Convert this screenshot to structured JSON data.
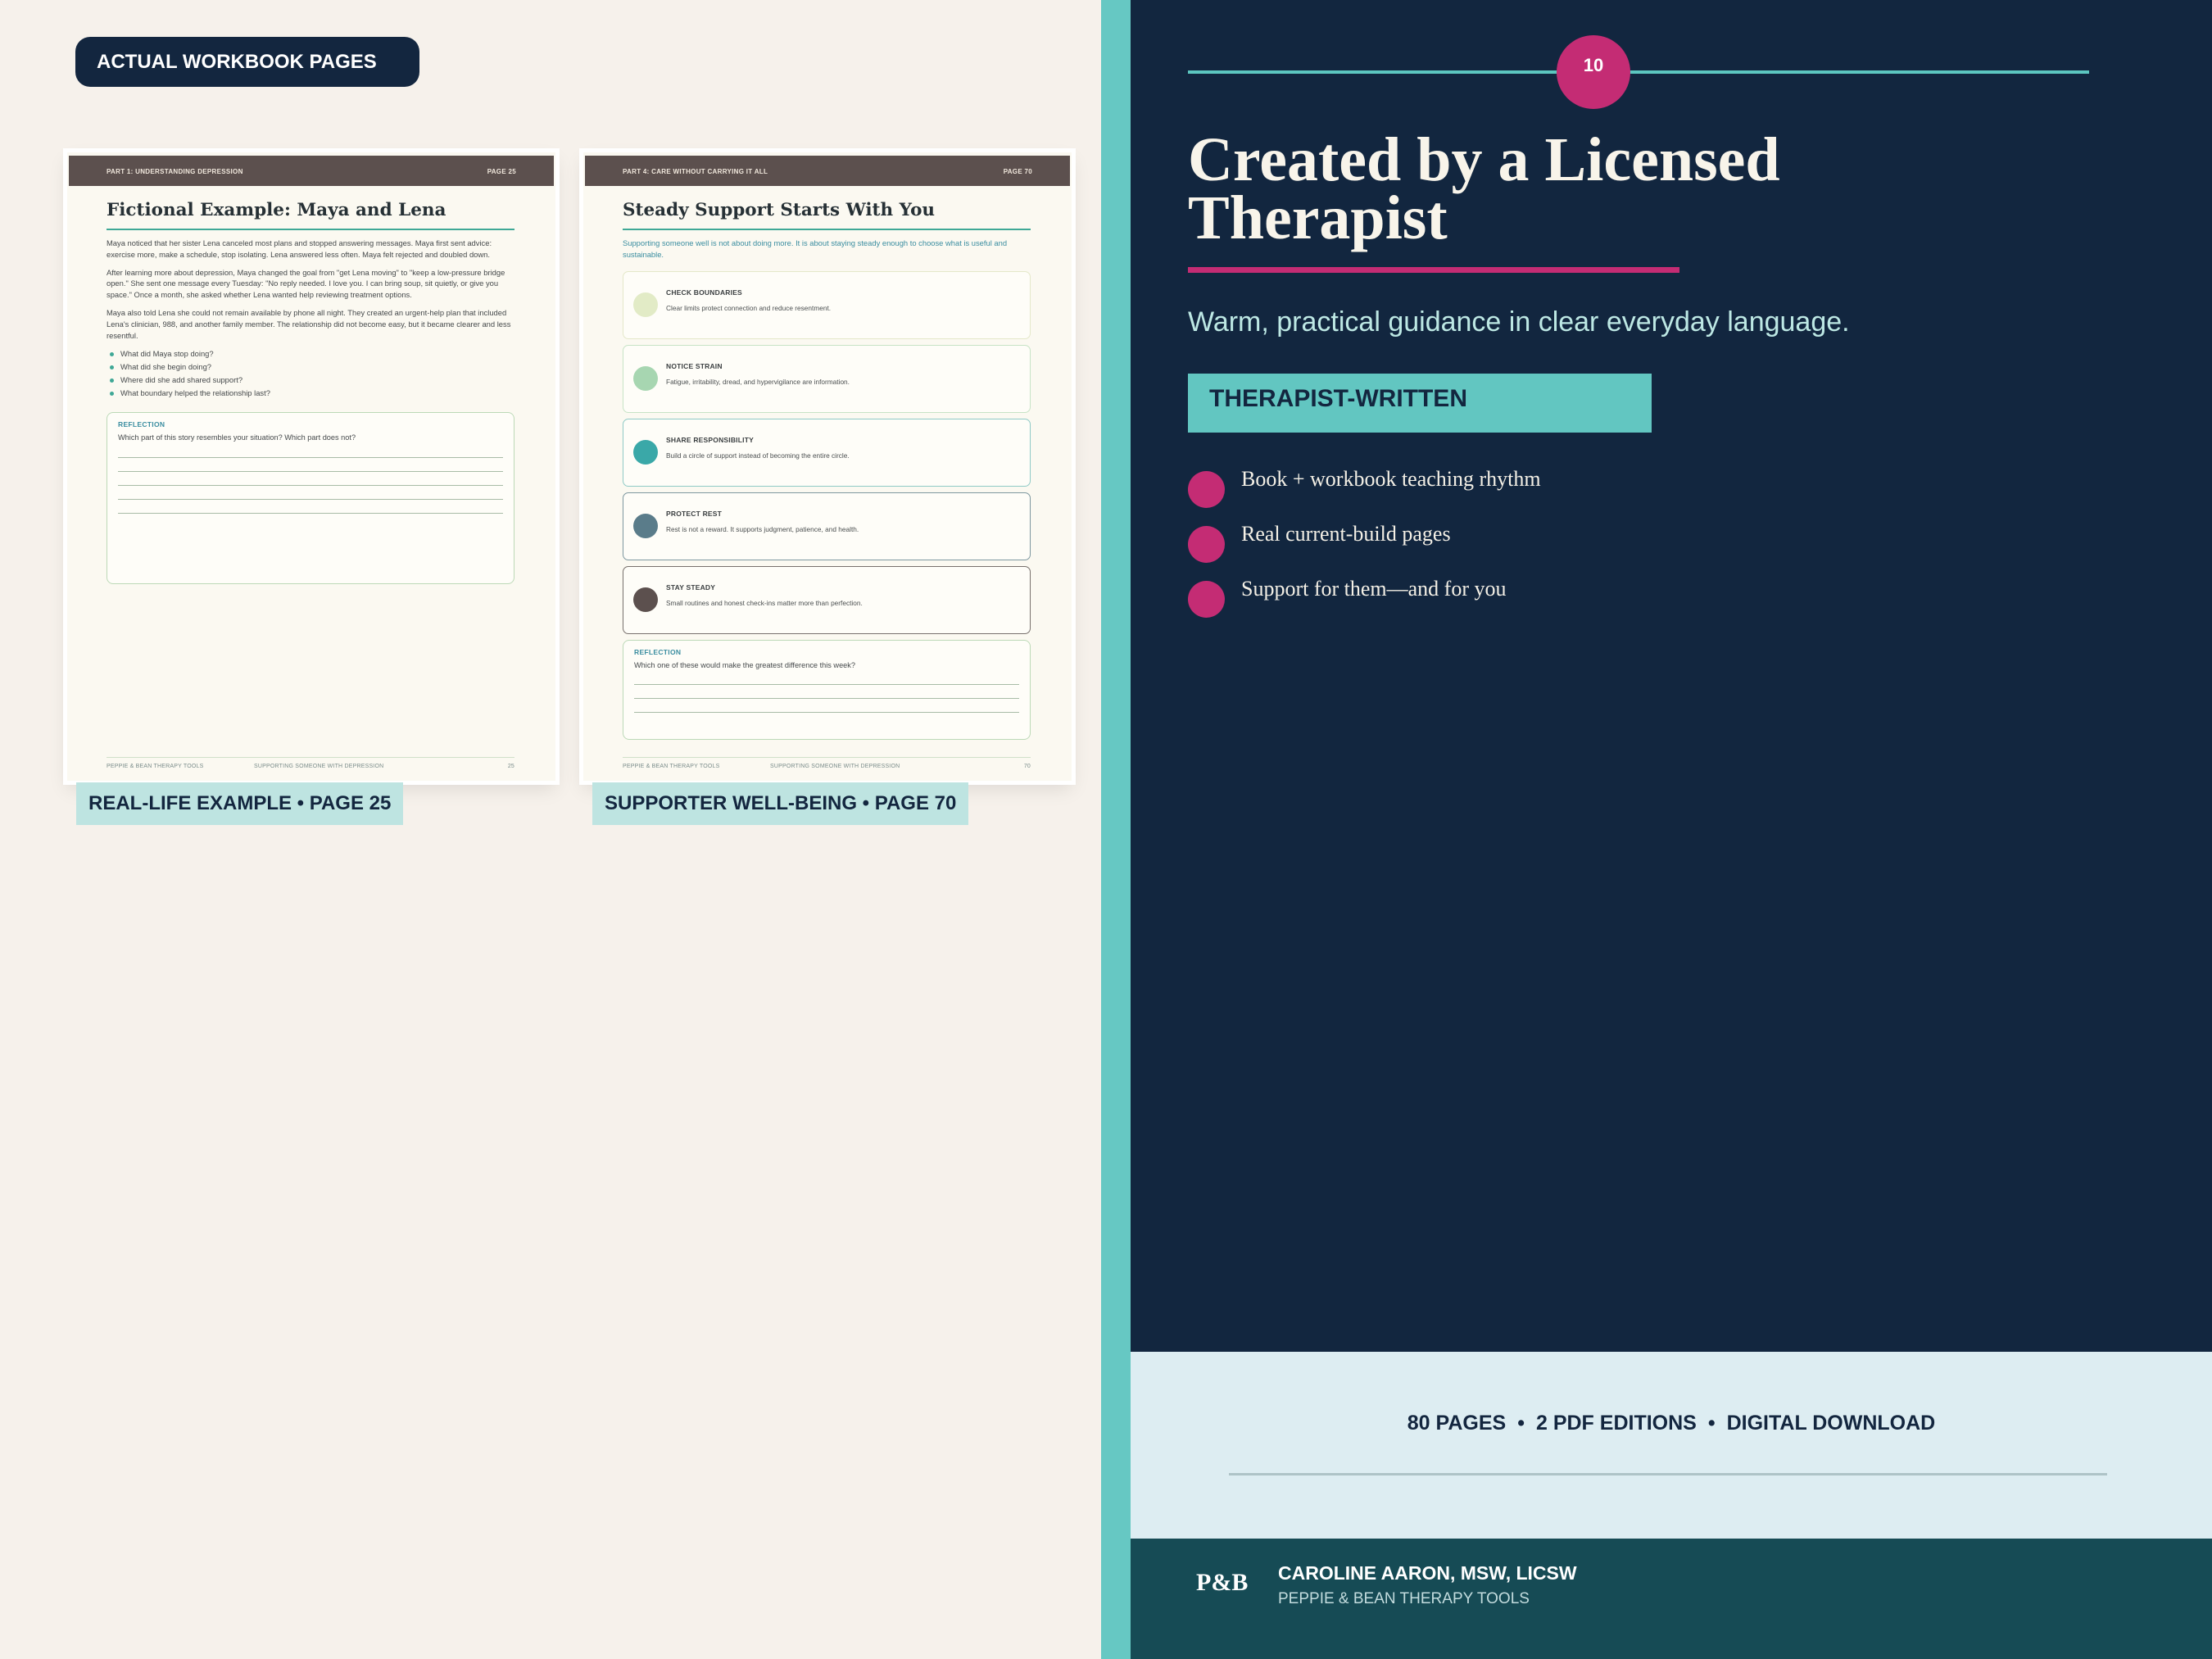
{
  "badge": "ACTUAL WORKBOOK PAGES",
  "page1": {
    "header_left": "PART 1: UNDERSTANDING DEPRESSION",
    "header_right": "PAGE 25",
    "title": "Fictional Example: Maya and Lena",
    "paragraphs": [
      "Maya noticed that her sister Lena canceled most plans and stopped answering messages. Maya first sent advice: exercise more, make a schedule, stop isolating. Lena answered less often. Maya felt rejected and doubled down.",
      "After learning more about depression, Maya changed the goal from \"get Lena moving\" to \"keep a low-pressure bridge open.\" She sent one message every Tuesday: \"No reply needed. I love you. I can bring soup, sit quietly, or give you space.\" Once a month, she asked whether Lena wanted help reviewing treatment options.",
      "Maya also told Lena she could not remain available by phone all night. They created an urgent-help plan that included Lena's clinician, 988, and another family member. The relationship did not become easy, but it became clearer and less resentful."
    ],
    "bullets": [
      "What did Maya stop doing?",
      "What did she begin doing?",
      "Where did she add shared support?",
      "What boundary helped the relationship last?"
    ],
    "reflection_title": "REFLECTION",
    "reflection_question": "Which part of this story resembles your situation? Which part does not?",
    "footer_left": "PEPPIE & BEAN THERAPY TOOLS",
    "footer_mid": "SUPPORTING SOMEONE WITH DEPRESSION",
    "footer_right": "25"
  },
  "page2": {
    "header_left": "PART 4: CARE WITHOUT CARRYING IT ALL",
    "header_right": "PAGE 70",
    "title": "Steady Support Starts With You",
    "intro": "Supporting someone well is not about doing more. It is about staying steady enough to choose what is useful and sustainable.",
    "cards": [
      {
        "title": "CHECK BOUNDARIES",
        "desc": "Clear limits protect connection and reduce resentment.",
        "dot": "#e2ebc6",
        "border": "#e4e8c9"
      },
      {
        "title": "NOTICE STRAIN",
        "desc": "Fatigue, irritability, dread, and hypervigilance are information.",
        "dot": "#a7d6b1",
        "border": "#c7e3c6"
      },
      {
        "title": "SHARE RESPONSIBILITY",
        "desc": "Build a circle of support instead of becoming the entire circle.",
        "dot": "#3aa8a8",
        "border": "#8fcac6"
      },
      {
        "title": "PROTECT REST",
        "desc": "Rest is not a reward. It supports judgment, patience, and health.",
        "dot": "#5a7c8a",
        "border": "#7d979f"
      },
      {
        "title": "STAY STEADY",
        "desc": "Small routines and honest check-ins matter more than perfection.",
        "dot": "#5c504e",
        "border": "#77706c"
      }
    ],
    "reflection_title": "REFLECTION",
    "reflection_question": "Which one of these would make the greatest difference this week?",
    "footer_left": "PEPPIE & BEAN THERAPY TOOLS",
    "footer_mid": "SUPPORTING SOMEONE WITH DEPRESSION",
    "footer_right": "70"
  },
  "captions": [
    "REAL-LIFE EXAMPLE • PAGE 25",
    "SUPPORTER WELL-BEING • PAGE 70"
  ],
  "right": {
    "number": "10",
    "headline_line1": "Created by a Licensed",
    "headline_line2": "Therapist",
    "subhead": "Warm, practical guidance in clear everyday language.",
    "tag": "THERAPIST-WRITTEN",
    "bullets": [
      "Book + workbook teaching rhythm",
      "Real current-build pages",
      "Support for them—and for you"
    ],
    "specs": [
      "80 PAGES",
      "2 PDF EDITIONS",
      "DIGITAL DOWNLOAD"
    ],
    "spec_sep": "•",
    "logo": "P&B",
    "author": "CAROLINE AARON, MSW, LICSW",
    "org": "PEPPIE & BEAN THERAPY TOOLS"
  },
  "colors": {
    "navy": "#12263f",
    "magenta": "#c42c74",
    "teal": "#66c8c3",
    "cream": "#f6f1eb"
  }
}
